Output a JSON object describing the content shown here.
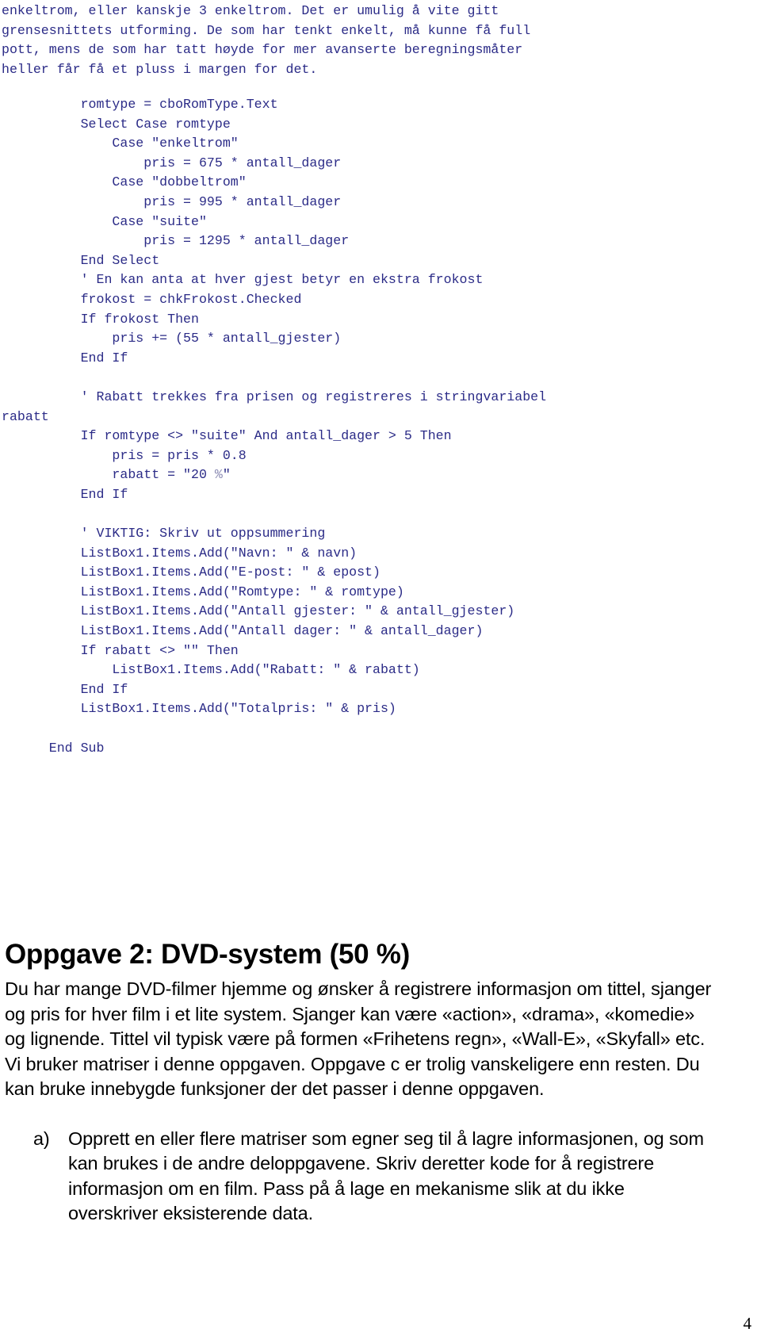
{
  "document": {
    "page_number": "4",
    "code_color": "#2b2b87",
    "body_color": "#000000"
  },
  "intro_paragraph": {
    "lines": [
      "enkeltrom, eller kanskje 3 enkeltrom. Det er umulig å vite gitt",
      "grensesnittets utforming. De som har tenkt enkelt, må kunne få full",
      "pott, mens de som har tatt høyde for mer avanserte beregningsmåter",
      "heller får få et pluss i margen for det."
    ]
  },
  "code_listing": {
    "lines": [
      "          romtype = cboRomType.Text",
      "          Select Case romtype",
      "              Case \"enkeltrom\"",
      "                  pris = 675 * antall_dager",
      "              Case \"dobbeltrom\"",
      "                  pris = 995 * antall_dager",
      "              Case \"suite\"",
      "                  pris = 1295 * antall_dager",
      "          End Select",
      "          ' En kan anta at hver gjest betyr en ekstra frokost",
      "          frokost = chkFrokost.Checked",
      "          If frokost Then",
      "              pris += (55 * antall_gjester)",
      "          End If",
      "",
      "          ' Rabatt trekkes fra prisen og registreres i stringvariabel",
      "rabatt",
      "          If romtype <> \"suite\" And antall_dager > 5 Then",
      "              pris = pris * 0.8",
      "              rabatt = \"20 %\"",
      "          End If",
      "",
      "          ' VIKTIG: Skriv ut oppsummering",
      "          ListBox1.Items.Add(\"Navn: \" & navn)",
      "          ListBox1.Items.Add(\"E-post: \" & epost)",
      "          ListBox1.Items.Add(\"Romtype: \" & romtype)",
      "          ListBox1.Items.Add(\"Antall gjester: \" & antall_gjester)",
      "          ListBox1.Items.Add(\"Antall dager: \" & antall_dager)",
      "          If rabatt <> \"\" Then",
      "              ListBox1.Items.Add(\"Rabatt: \" & rabatt)",
      "          End If",
      "          ListBox1.Items.Add(\"Totalpris: \" & pris)",
      "",
      "      End Sub"
    ]
  },
  "task": {
    "heading": "Oppgave 2: DVD-system (50 %)",
    "intro": "Du har mange DVD-filmer hjemme og ønsker å registrere informasjon om tittel, sjanger og pris for hver film i et lite system. Sjanger kan være «action», «drama», «komedie» og lignende. Tittel vil typisk være på formen «Frihetens regn», «Wall-E», «Skyfall» etc. Vi bruker matriser i denne oppgaven. Oppgave c er trolig vanskeligere enn resten. Du kan bruke innebygde funksjoner der det passer i denne oppgaven.",
    "items": [
      {
        "marker": "a)",
        "text": "Opprett en eller flere matriser som egner seg til å lagre informasjonen, og som kan brukes i de andre deloppgavene. Skriv deretter kode for å registrere informasjon om en film. Pass på å lage en mekanisme slik at du ikke overskriver eksisterende data."
      }
    ]
  }
}
